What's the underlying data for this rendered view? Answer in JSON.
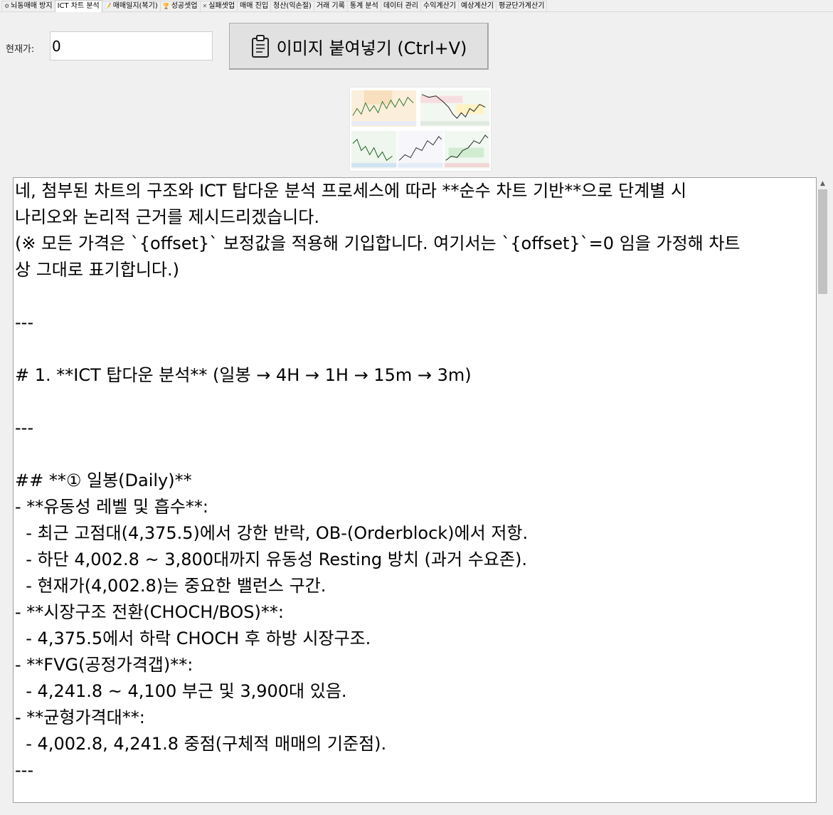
{
  "tabs": [
    {
      "label": "뇌동매매 방지",
      "icon": "gear-icon",
      "glyph": "⚙"
    },
    {
      "label": "ICT 차트 분석",
      "icon": "",
      "glyph": ""
    },
    {
      "label": "매매일지(복기)",
      "icon": "notebook-icon",
      "glyph": "📝"
    },
    {
      "label": "성공셋업",
      "icon": "trophy-icon",
      "glyph": "🏆"
    },
    {
      "label": "실패셋업",
      "icon": "x-icon",
      "glyph": "✕"
    },
    {
      "label": "매매 진입",
      "icon": "",
      "glyph": ""
    },
    {
      "label": "청산(익손절)",
      "icon": "",
      "glyph": ""
    },
    {
      "label": "거래 기록",
      "icon": "",
      "glyph": ""
    },
    {
      "label": "통계 분석",
      "icon": "",
      "glyph": ""
    },
    {
      "label": "데이터 관리",
      "icon": "",
      "glyph": ""
    },
    {
      "label": "수익계산기",
      "icon": "",
      "glyph": ""
    },
    {
      "label": "예상계산기",
      "icon": "",
      "glyph": ""
    },
    {
      "label": "평균단가계산기",
      "icon": "",
      "glyph": ""
    }
  ],
  "active_tab_index": 1,
  "form": {
    "price_label": "현재가:",
    "price_value": "0",
    "paste_button_label": "이미지 붙여넣기 (Ctrl+V)",
    "paste_button_icon": "clipboard-icon"
  },
  "thumbnail": {
    "icon": "chart-thumbnail-image"
  },
  "analysis_lines": [
    "네, 첨부된 차트의 구조와 ICT 탑다운 분석 프로세스에 따라 **순수 차트 기반**으로 단계별 시",
    "나리오와 논리적 근거를 제시드리겠습니다.",
    "(※ 모든 가격은 `{offset}` 보정값을 적용해 기입합니다. 여기서는 `{offset}`=0 임을 가정해 차트",
    "상 그대로 표기합니다.)",
    "",
    "---",
    "",
    "# 1. **ICT 탑다운 분석** (일봉 → 4H → 1H → 15m → 3m)",
    "",
    "---",
    "",
    "## **① 일봉(Daily)**",
    "- **유동성 레벨 및 흡수**:",
    "  - 최근 고점대(4,375.5)에서 강한 반락, OB-(Orderblock)에서 저항.",
    "  - 하단 4,002.8 ~ 3,800대까지 유동성 Resting 방치 (과거 수요존).",
    "  - 현재가(4,002.8)는 중요한 밸런스 구간.",
    "- **시장구조 전환(CHOCH/BOS)**:",
    "  - 4,375.5에서 하락 CHOCH 후 하방 시장구조.",
    "- **FVG(공정가격갭)**:",
    "  - 4,241.8 ~ 4,100 부근 및 3,900대 있음.",
    "- **균형가격대**:",
    "  - 4,002.8, 4,241.8 중점(구체적 매매의 기준점).",
    "---"
  ]
}
